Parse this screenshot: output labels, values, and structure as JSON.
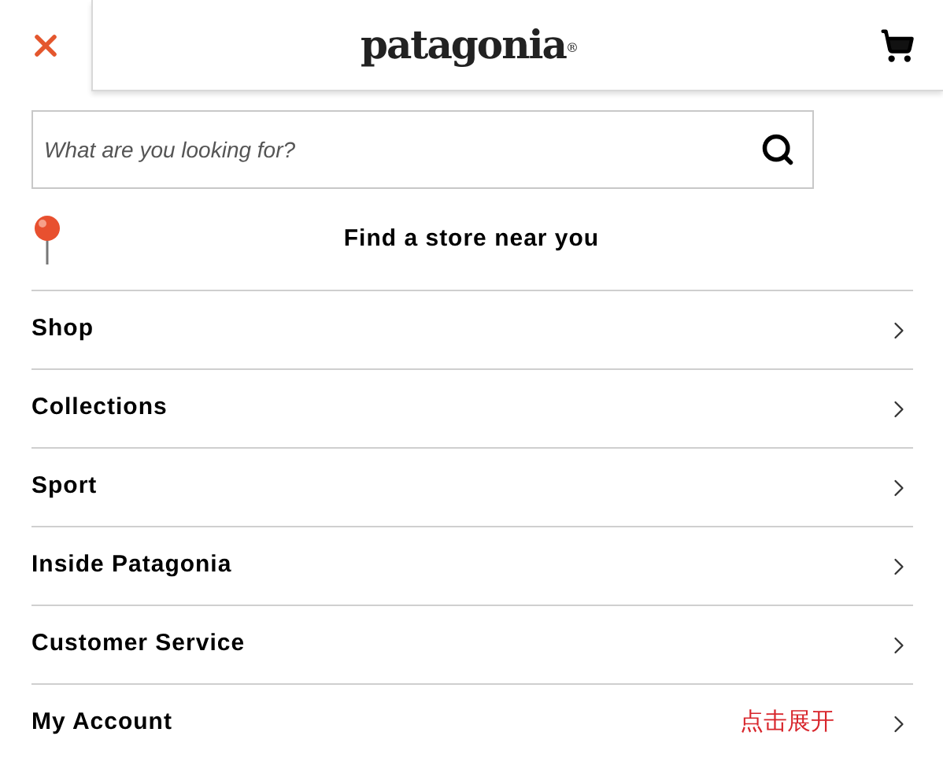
{
  "header": {
    "logo": "patagonia",
    "logo_mark": "®"
  },
  "search": {
    "placeholder": "What are you looking for?"
  },
  "store_link": "Find a store near you",
  "menu": [
    {
      "label": "Shop"
    },
    {
      "label": "Collections"
    },
    {
      "label": "Sport"
    },
    {
      "label": "Inside Patagonia"
    },
    {
      "label": "Customer Service"
    },
    {
      "label": "My Account",
      "note": "点击展开"
    }
  ]
}
